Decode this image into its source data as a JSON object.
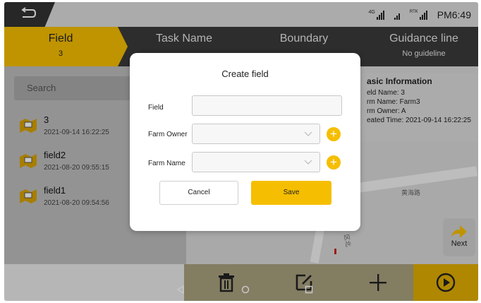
{
  "status_bar": {
    "network_label": "4G",
    "rtk_label": "RTK",
    "time": "PM6:49"
  },
  "tabs": [
    {
      "label": "Field",
      "sub": "3"
    },
    {
      "label": "Task Name",
      "sub": ""
    },
    {
      "label": "Boundary",
      "sub": ""
    },
    {
      "label": "Guidance line",
      "sub": "No guideline"
    }
  ],
  "search": {
    "placeholder": "Search"
  },
  "fields": [
    {
      "name": "3",
      "date": "2021-09-14 16:22:25"
    },
    {
      "name": "field2",
      "date": "2021-08-20 09:55:15"
    },
    {
      "name": "field1",
      "date": "2021-08-20 09:54:56"
    }
  ],
  "info_panel": {
    "title": "asic Information",
    "field_name": "eld Name: 3",
    "farm_name": "rm Name: Farm3",
    "farm_owner": "rm Owner: A",
    "created": "eated Time: 2021-09-14 16:22:25"
  },
  "map": {
    "road_label": "黄海路",
    "road_label_2": "区北"
  },
  "next_button": {
    "label": "Next"
  },
  "dialog": {
    "title": "Create field",
    "field_label": "Field",
    "field_value": "",
    "farm_owner_label": "Farm Owner",
    "farm_owner_value": "",
    "farm_name_label": "Farm Name",
    "farm_name_value": "",
    "cancel_label": "Cancel",
    "save_label": "Save"
  },
  "colors": {
    "accent": "#f5be00",
    "tab_bg": "#3a3a3a"
  },
  "toolbar_icons": [
    "trash-icon",
    "edit-icon",
    "plus-icon",
    "play-icon"
  ]
}
